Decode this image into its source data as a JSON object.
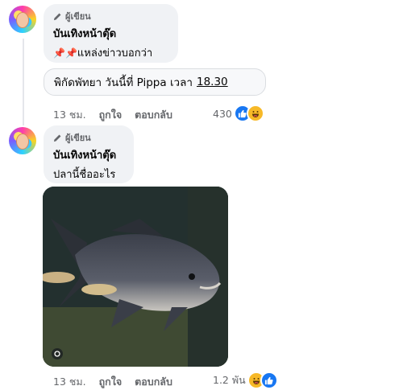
{
  "comments": [
    {
      "badge": "ผู้เขียน",
      "author": "บันเทิงหน้าตุ๊ด",
      "pins": "📌📌",
      "text": "แหล่งข่าวบอกว่า",
      "attachment_text": "พิกัดพัทยา วันนี้ที่ Pippa เวลา",
      "attachment_time": "18.30",
      "timestamp": "13 ชม.",
      "like_label": "ถูกใจ",
      "reply_label": "ตอบกลับ",
      "reaction_count": "430",
      "reactions": [
        "like-icon",
        "haha-icon"
      ]
    },
    {
      "badge": "ผู้เขียน",
      "author": "บันเทิงหน้าตุ๊ด",
      "text": "ปลานี้ชื่ออะไร",
      "photo_desc": "fish-photo",
      "timestamp": "13 ชม.",
      "like_label": "ถูกใจ",
      "reply_label": "ตอบกลับ",
      "reaction_count": "1.2 พัน",
      "reactions": [
        "haha-icon",
        "like-icon"
      ]
    }
  ],
  "colors": {
    "bubble": "#f0f2f5",
    "meta_text": "#65676b",
    "like_blue": "#1877f2",
    "haha_yellow": "#f7b928"
  }
}
